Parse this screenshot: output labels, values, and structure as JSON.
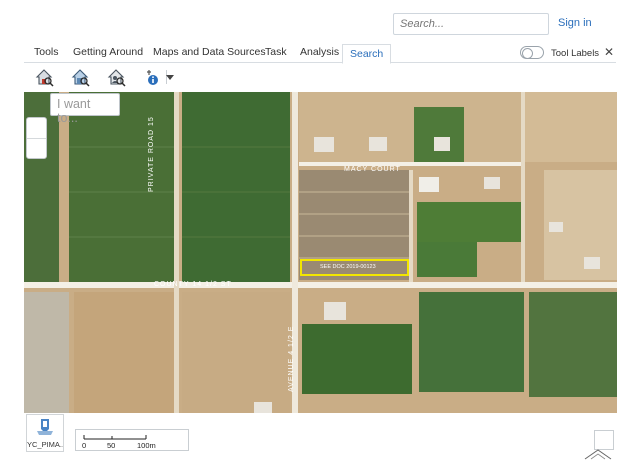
{
  "header": {
    "search_placeholder": "Search...",
    "sign_in": "Sign in"
  },
  "tabs": [
    {
      "label": "Tools",
      "active": false
    },
    {
      "label": "Getting Around",
      "active": false
    },
    {
      "label": "Maps and Data Sources",
      "active": false
    },
    {
      "label": "Task",
      "active": false
    },
    {
      "label": "Analysis",
      "active": false
    },
    {
      "label": "Search",
      "active": true
    }
  ],
  "tool_labels": {
    "label": "Tool Labels",
    "enabled": false
  },
  "toolbar": {
    "icons": [
      "search-address-icon",
      "search-parcel-icon",
      "search-owner-icon",
      "identify-icon",
      "dropdown-chevron-icon"
    ]
  },
  "map": {
    "i_want_to": "I want to...",
    "roads": [
      "MACY COURT",
      "COUNTY 14 1/2 ST",
      "PRIVATE ROAD 15",
      "AVENUE 4 1/2 E"
    ],
    "selected_parcel_label": "SEE DOC 2019-00123",
    "colors": {
      "field_green": "#3f6b33",
      "dirt": "#cdb18a",
      "selection": "#f2e600",
      "road": "#f4f0e6"
    }
  },
  "basemap": {
    "label": "YC_PIMA..."
  },
  "scalebar": {
    "labels": [
      "0",
      "50",
      "100m"
    ]
  }
}
